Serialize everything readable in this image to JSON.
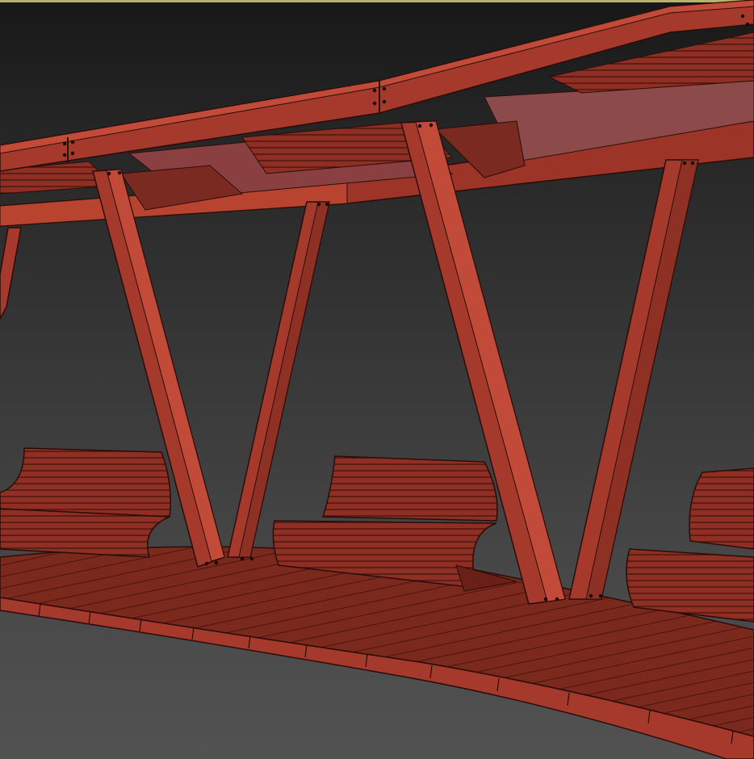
{
  "viewport": {
    "background_top": "#181818",
    "background_bottom": "#525252",
    "border_color": "#b8b36a"
  },
  "scene": {
    "model_color": "#a53a2c",
    "model_color_light": "#c24a38",
    "model_color_dark": "#6a1f17",
    "edge_color": "#2a0d09",
    "objects": {
      "canopy_beams": 2,
      "v_columns": 4,
      "benches": 3,
      "deck_platform": 1
    }
  }
}
